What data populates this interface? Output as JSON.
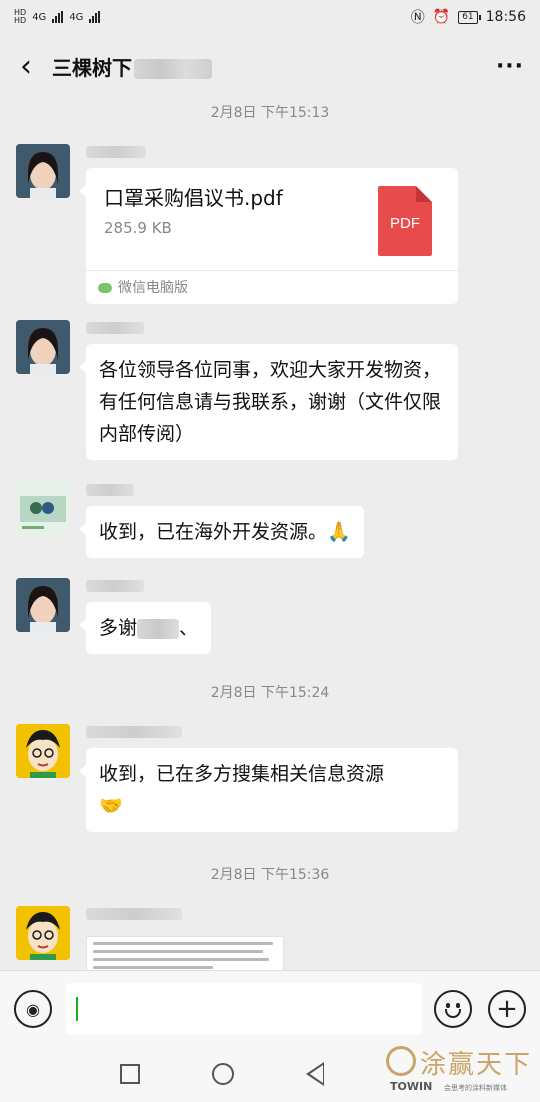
{
  "status_bar": {
    "network_1": "4G",
    "network_2": "4G",
    "battery": "61",
    "time": "18:56"
  },
  "header": {
    "back_icon": "chevron-left-icon",
    "title": "三棵树下",
    "more_icon": "more-dots-icon"
  },
  "messages": {
    "time_1": "2月8日 下午15:13",
    "file": {
      "name": "口罩采购倡议书.pdf",
      "size": "285.9 KB",
      "badge": "PDF",
      "source": "微信电脑版"
    },
    "text_1": "各位领导各位同事，欢迎大家开发物资，有任何信息请与我联系，谢谢（文件仅限内部传阅）",
    "text_2": "收到，已在海外开发资源。",
    "text_2_emoji": "🙏",
    "text_3_prefix": "多谢",
    "text_3_suffix": "、",
    "time_2": "2月8日 下午15:24",
    "text_4": "收到，已在多方搜集相关信息资源",
    "text_4_emoji": "🤝",
    "time_3": "2月8日 下午15:36"
  },
  "input_bar": {
    "voice_icon": "voice-icon",
    "emoji_icon": "emoji-icon",
    "plus_icon": "plus-icon"
  },
  "watermark": {
    "cn": "涂赢天下",
    "en": "TOWIN",
    "slogan": "会思考的涂料新媒体"
  }
}
